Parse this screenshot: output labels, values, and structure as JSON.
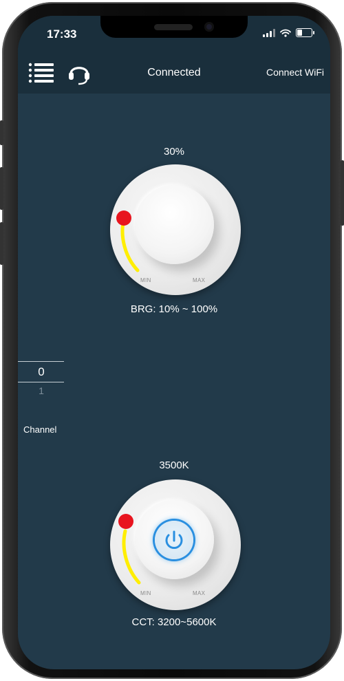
{
  "status_bar": {
    "time": "17:33"
  },
  "header": {
    "title": "Connected",
    "connect_wifi_label": "Connect WiFi"
  },
  "brightness": {
    "value_label": "30%",
    "level_percent": 30,
    "range_label": "BRG: 10% ~ 100%",
    "min_label": "MIN",
    "max_label": "MAX"
  },
  "channel": {
    "current": "0",
    "next": "1",
    "label": "Channel"
  },
  "cct": {
    "value_label": "3500K",
    "range_label": "CCT: 3200~5600K",
    "min_label": "MIN",
    "max_label": "MAX"
  },
  "colors": {
    "background": "#223a4a",
    "topbar": "#1a2f3c",
    "indicator_dot": "#e8141e",
    "level_arc": "#ffee00",
    "power_accent": "#2a8fe0"
  }
}
